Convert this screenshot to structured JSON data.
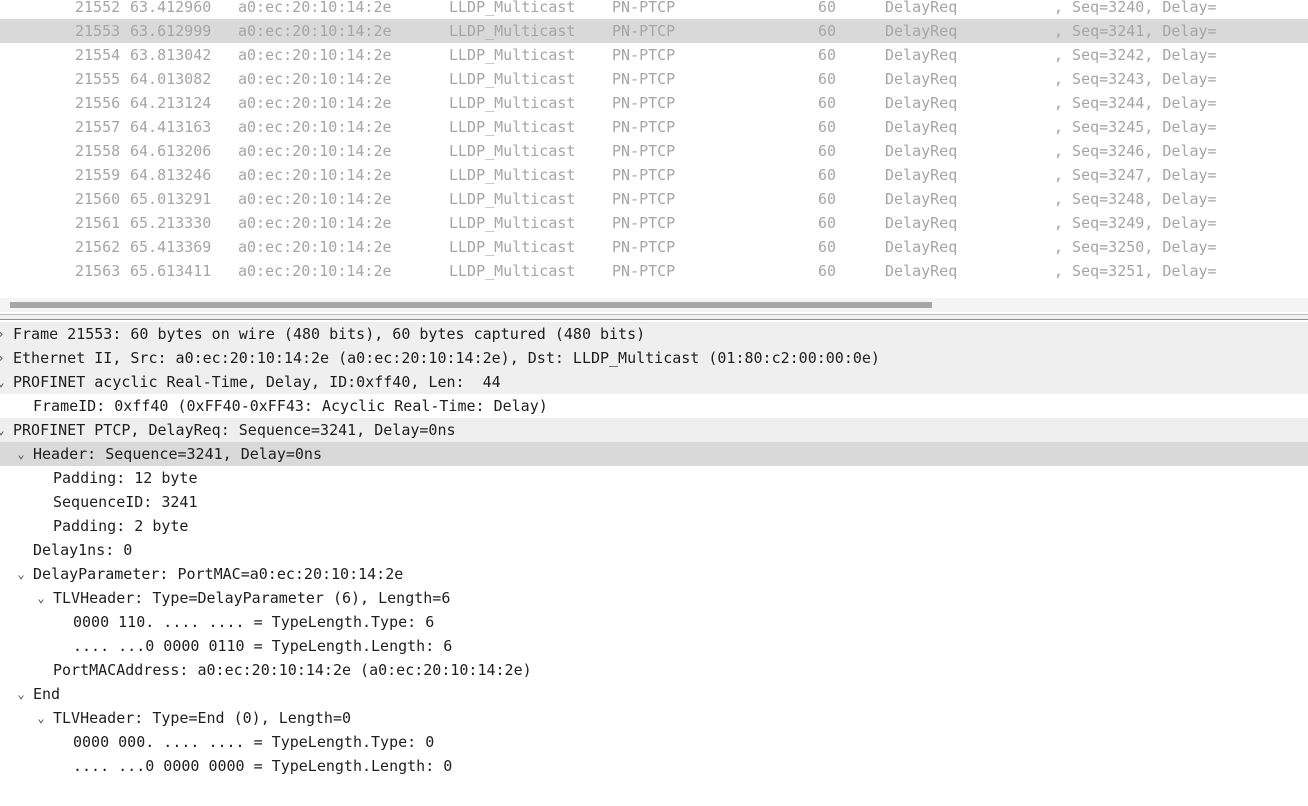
{
  "packet_list": {
    "rows": [
      {
        "no": "21552",
        "time": "63.412960",
        "source": "a0:ec:20:10:14:2e",
        "destination": "LLDP_Multicast",
        "protocol": "PN-PTCP",
        "length": "60",
        "info": "DelayReq",
        "seq": ", Seq=3240, Delay=",
        "selected": false
      },
      {
        "no": "21553",
        "time": "63.612999",
        "source": "a0:ec:20:10:14:2e",
        "destination": "LLDP_Multicast",
        "protocol": "PN-PTCP",
        "length": "60",
        "info": "DelayReq",
        "seq": ", Seq=3241, Delay=",
        "selected": true
      },
      {
        "no": "21554",
        "time": "63.813042",
        "source": "a0:ec:20:10:14:2e",
        "destination": "LLDP_Multicast",
        "protocol": "PN-PTCP",
        "length": "60",
        "info": "DelayReq",
        "seq": ", Seq=3242, Delay=",
        "selected": false
      },
      {
        "no": "21555",
        "time": "64.013082",
        "source": "a0:ec:20:10:14:2e",
        "destination": "LLDP_Multicast",
        "protocol": "PN-PTCP",
        "length": "60",
        "info": "DelayReq",
        "seq": ", Seq=3243, Delay=",
        "selected": false
      },
      {
        "no": "21556",
        "time": "64.213124",
        "source": "a0:ec:20:10:14:2e",
        "destination": "LLDP_Multicast",
        "protocol": "PN-PTCP",
        "length": "60",
        "info": "DelayReq",
        "seq": ", Seq=3244, Delay=",
        "selected": false
      },
      {
        "no": "21557",
        "time": "64.413163",
        "source": "a0:ec:20:10:14:2e",
        "destination": "LLDP_Multicast",
        "protocol": "PN-PTCP",
        "length": "60",
        "info": "DelayReq",
        "seq": ", Seq=3245, Delay=",
        "selected": false
      },
      {
        "no": "21558",
        "time": "64.613206",
        "source": "a0:ec:20:10:14:2e",
        "destination": "LLDP_Multicast",
        "protocol": "PN-PTCP",
        "length": "60",
        "info": "DelayReq",
        "seq": ", Seq=3246, Delay=",
        "selected": false
      },
      {
        "no": "21559",
        "time": "64.813246",
        "source": "a0:ec:20:10:14:2e",
        "destination": "LLDP_Multicast",
        "protocol": "PN-PTCP",
        "length": "60",
        "info": "DelayReq",
        "seq": ", Seq=3247, Delay=",
        "selected": false
      },
      {
        "no": "21560",
        "time": "65.013291",
        "source": "a0:ec:20:10:14:2e",
        "destination": "LLDP_Multicast",
        "protocol": "PN-PTCP",
        "length": "60",
        "info": "DelayReq",
        "seq": ", Seq=3248, Delay=",
        "selected": false
      },
      {
        "no": "21561",
        "time": "65.213330",
        "source": "a0:ec:20:10:14:2e",
        "destination": "LLDP_Multicast",
        "protocol": "PN-PTCP",
        "length": "60",
        "info": "DelayReq",
        "seq": ", Seq=3249, Delay=",
        "selected": false
      },
      {
        "no": "21562",
        "time": "65.413369",
        "source": "a0:ec:20:10:14:2e",
        "destination": "LLDP_Multicast",
        "protocol": "PN-PTCP",
        "length": "60",
        "info": "DelayReq",
        "seq": ", Seq=3250, Delay=",
        "selected": false
      },
      {
        "no": "21563",
        "time": "65.613411",
        "source": "a0:ec:20:10:14:2e",
        "destination": "LLDP_Multicast",
        "protocol": "PN-PTCP",
        "length": "60",
        "info": "DelayReq",
        "seq": ", Seq=3251, Delay=",
        "selected": false
      }
    ]
  },
  "details": {
    "rows": [
      {
        "text": "Frame 21553: 60 bytes on wire (480 bits), 60 bytes captured (480 bits)",
        "depth": 0,
        "toggle": "collapsed",
        "toplevel": true,
        "selected": false
      },
      {
        "text": "Ethernet II, Src: a0:ec:20:10:14:2e (a0:ec:20:10:14:2e), Dst: LLDP_Multicast (01:80:c2:00:00:0e)",
        "depth": 0,
        "toggle": "collapsed",
        "toplevel": true,
        "selected": false
      },
      {
        "text": "PROFINET acyclic Real-Time, Delay, ID:0xff40, Len:  44",
        "depth": 0,
        "toggle": "expanded",
        "toplevel": true,
        "selected": false
      },
      {
        "text": "FrameID: 0xff40 (0xFF40-0xFF43: Acyclic Real-Time: Delay)",
        "depth": 1,
        "toggle": "none",
        "toplevel": false,
        "selected": false
      },
      {
        "text": "PROFINET PTCP, DelayReq: Sequence=3241, Delay=0ns",
        "depth": 0,
        "toggle": "expanded",
        "toplevel": true,
        "selected": false
      },
      {
        "text": "Header: Sequence=3241, Delay=0ns",
        "depth": 1,
        "toggle": "expanded",
        "toplevel": false,
        "selected": true
      },
      {
        "text": "Padding: 12 byte",
        "depth": 2,
        "toggle": "none",
        "toplevel": false,
        "selected": false
      },
      {
        "text": "SequenceID: 3241",
        "depth": 2,
        "toggle": "none",
        "toplevel": false,
        "selected": false
      },
      {
        "text": "Padding: 2 byte",
        "depth": 2,
        "toggle": "none",
        "toplevel": false,
        "selected": false
      },
      {
        "text": "Delay1ns: 0",
        "depth": 1,
        "toggle": "none",
        "toplevel": false,
        "selected": false
      },
      {
        "text": "DelayParameter: PortMAC=a0:ec:20:10:14:2e",
        "depth": 1,
        "toggle": "expanded",
        "toplevel": false,
        "selected": false
      },
      {
        "text": "TLVHeader: Type=DelayParameter (6), Length=6",
        "depth": 2,
        "toggle": "expanded",
        "toplevel": false,
        "selected": false
      },
      {
        "text": "0000 110. .... .... = TypeLength.Type: 6",
        "depth": 3,
        "toggle": "none",
        "toplevel": false,
        "selected": false
      },
      {
        "text": ".... ...0 0000 0110 = TypeLength.Length: 6",
        "depth": 3,
        "toggle": "none",
        "toplevel": false,
        "selected": false
      },
      {
        "text": "PortMACAddress: a0:ec:20:10:14:2e (a0:ec:20:10:14:2e)",
        "depth": 2,
        "toggle": "none",
        "toplevel": false,
        "selected": false
      },
      {
        "text": "End",
        "depth": 1,
        "toggle": "expanded",
        "toplevel": false,
        "selected": false
      },
      {
        "text": "TLVHeader: Type=End (0), Length=0",
        "depth": 2,
        "toggle": "expanded",
        "toplevel": false,
        "selected": false
      },
      {
        "text": "0000 000. .... .... = TypeLength.Type: 0",
        "depth": 3,
        "toggle": "none",
        "toplevel": false,
        "selected": false
      },
      {
        "text": ".... ...0 0000 0000 = TypeLength.Length: 0",
        "depth": 3,
        "toggle": "none",
        "toplevel": false,
        "selected": false
      }
    ]
  },
  "icons": {
    "expanded": "⌄",
    "collapsed": "›"
  },
  "colors": {
    "selected_row": "#d9d9d9",
    "toplevel_row": "#efefef",
    "list_text": "#a6a6a6"
  }
}
